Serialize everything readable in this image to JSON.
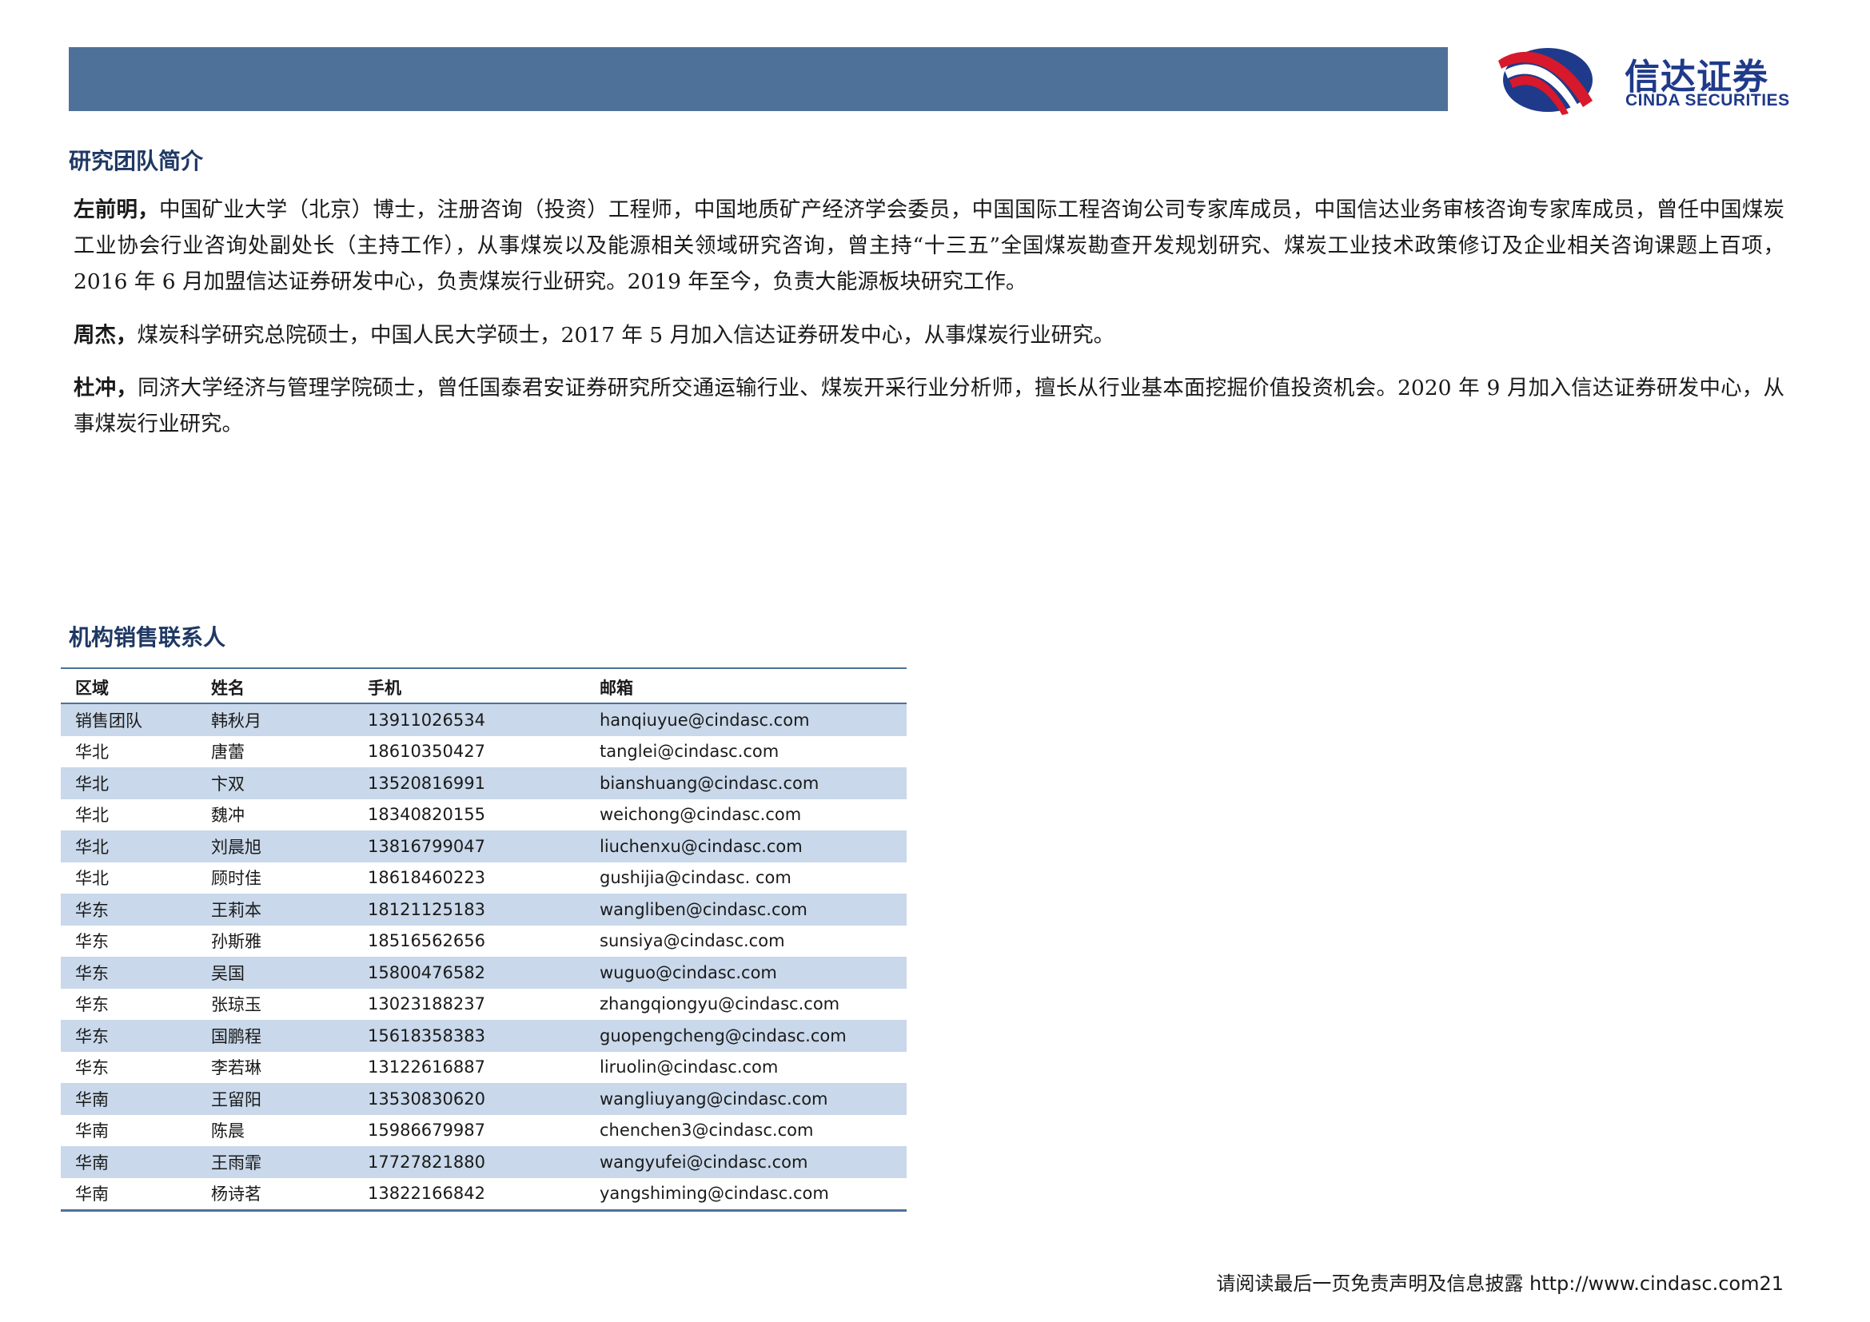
{
  "brand": {
    "name_cn": "信达证券",
    "name_en": "CINDA SECURITIES",
    "colors": {
      "header_bar": "#4e7199",
      "logo_blue": "#1f3a8a",
      "logo_red": "#d7192b",
      "row_shade": "#c9d8ea"
    }
  },
  "team": {
    "title": "研究团队简介",
    "members": [
      {
        "name": "左前明，",
        "bio": "中国矿业大学（北京）博士，注册咨询（投资）工程师，中国地质矿产经济学会委员，中国国际工程咨询公司专家库成员，中国信达业务审核咨询专家库成员，曾任中国煤炭工业协会行业咨询处副处长（主持工作），从事煤炭以及能源相关领域研究咨询，曾主持“十三五”全国煤炭勘查开发规划研究、煤炭工业技术政策修订及企业相关咨询课题上百项， 2016 年 6 月加盟信达证券研发中心，负责煤炭行业研究。2019 年至今，负责大能源板块研究工作。"
      },
      {
        "name": "周杰，",
        "bio": "煤炭科学研究总院硕士，中国人民大学硕士，2017 年 5 月加入信达证券研发中心，从事煤炭行业研究。"
      },
      {
        "name": "杜冲，",
        "bio": "同济大学经济与管理学院硕士，曾任国泰君安证券研究所交通运输行业、煤炭开采行业分析师，擅长从行业基本面挖掘价值投资机会。2020 年 9 月加入信达证券研发中心，从事煤炭行业研究。"
      }
    ]
  },
  "sales": {
    "title": "机构销售联系人",
    "headers": [
      "区域",
      "姓名",
      "手机",
      "邮箱"
    ],
    "rows": [
      [
        "销售团队",
        "韩秋月",
        "13911026534",
        "hanqiuyue@cindasc.com"
      ],
      [
        "华北",
        "唐蕾",
        "18610350427",
        "tanglei@cindasc.com"
      ],
      [
        "华北",
        "卞双",
        "13520816991",
        "bianshuang@cindasc.com"
      ],
      [
        "华北",
        "魏冲",
        "18340820155",
        "weichong@cindasc.com"
      ],
      [
        "华北",
        "刘晨旭",
        "13816799047",
        "liuchenxu@cindasc.com"
      ],
      [
        "华北",
        "顾时佳",
        "18618460223",
        "gushijia@cindasc. com"
      ],
      [
        "华东",
        "王莉本",
        "18121125183",
        "wangliben@cindasc.com"
      ],
      [
        "华东",
        "孙斯雅",
        "18516562656",
        "sunsiya@cindasc.com"
      ],
      [
        "华东",
        "吴国",
        "15800476582",
        "wuguo@cindasc.com"
      ],
      [
        "华东",
        "张琼玉",
        "13023188237",
        "zhangqiongyu@cindasc.com"
      ],
      [
        "华东",
        "国鹏程",
        "15618358383",
        "guopengcheng@cindasc.com"
      ],
      [
        "华东",
        "李若琳",
        "13122616887",
        "liruolin@cindasc.com"
      ],
      [
        "华南",
        "王留阳",
        "13530830620",
        "wangliuyang@cindasc.com"
      ],
      [
        "华南",
        "陈晨",
        "15986679987",
        "chenchen3@cindasc.com"
      ],
      [
        "华南",
        "王雨霏",
        "17727821880",
        "wangyufei@cindasc.com"
      ],
      [
        "华南",
        "杨诗茗",
        "13822166842",
        "yangshiming@cindasc.com"
      ]
    ]
  },
  "footer": {
    "disclaimer": "请阅读最后一页免责声明及信息披露",
    "url": "http://www.cindasc.com",
    "page": "21"
  }
}
